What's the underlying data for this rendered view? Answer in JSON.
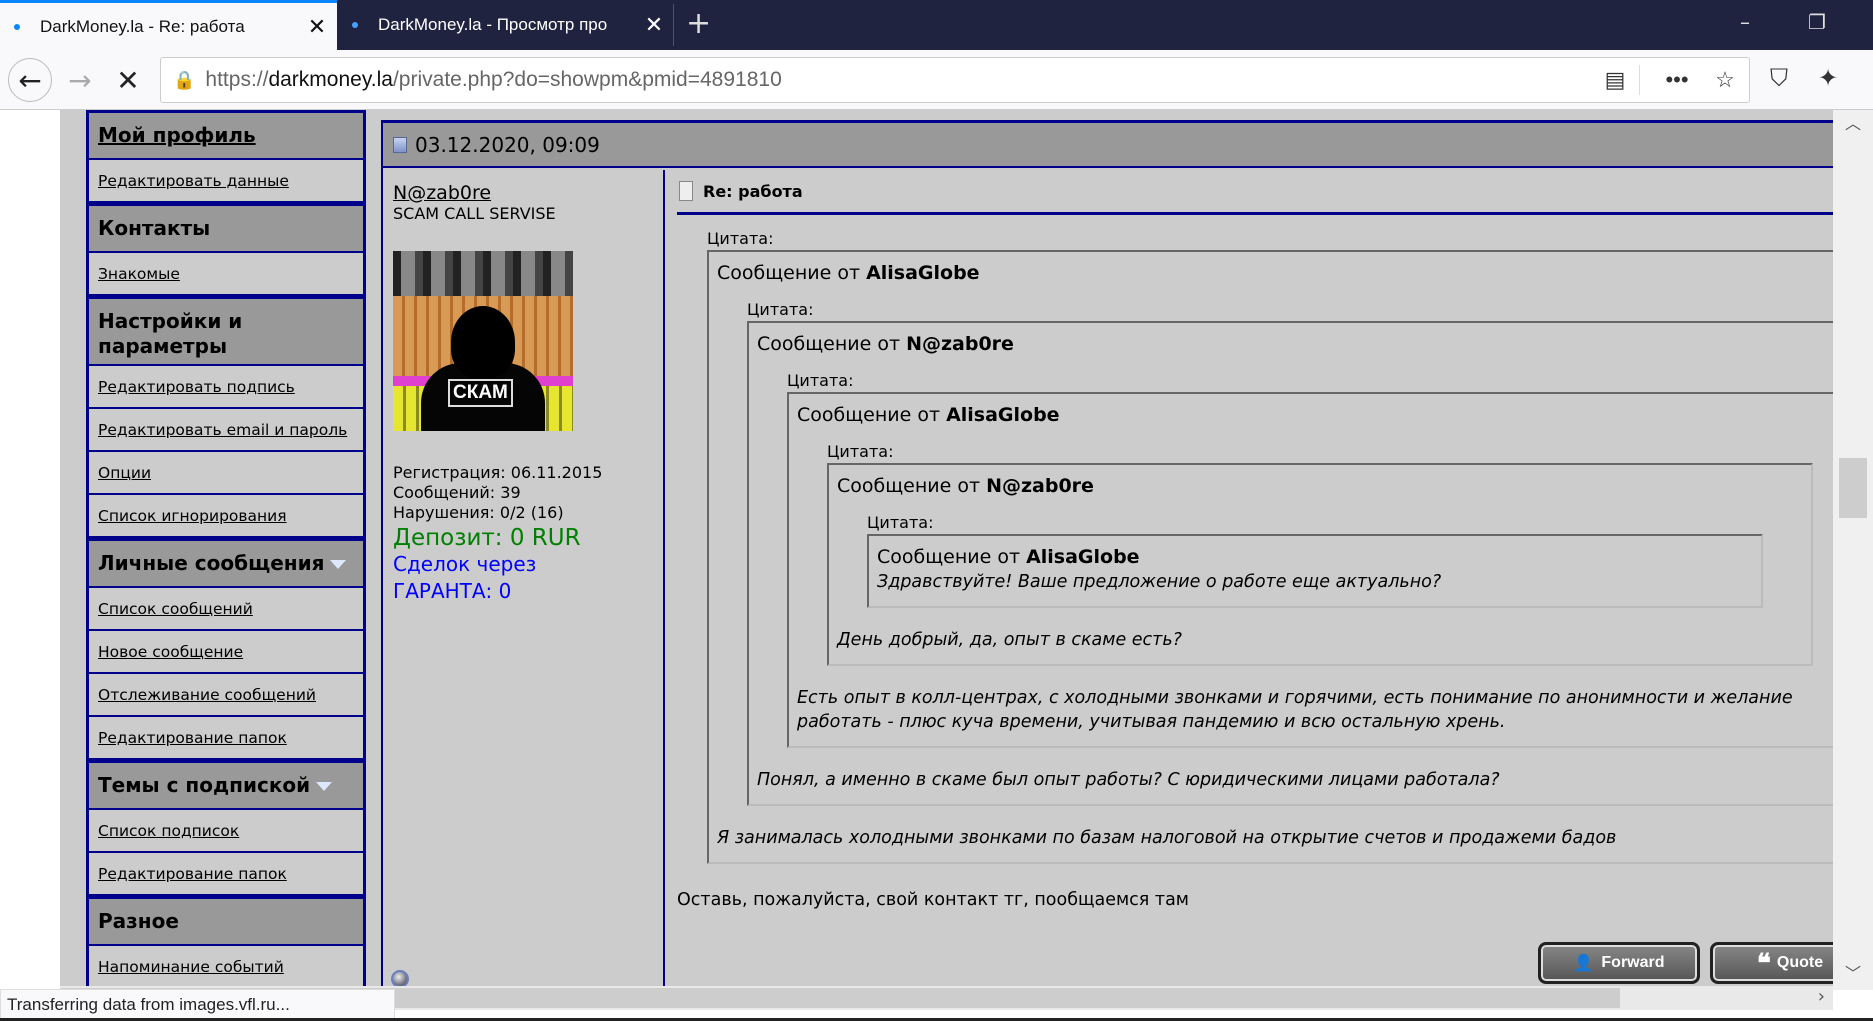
{
  "browser": {
    "tabs": [
      {
        "title": "DarkMoney.la - Re: работа",
        "active": true
      },
      {
        "title": "DarkMoney.la - Просмотр про",
        "active": false
      }
    ],
    "url_scheme": "https://",
    "url_host": "darkmoney.la",
    "url_path": "/private.php?do=showpm&pmid=4891810",
    "status_text": "Transferring data from images.vfl.ru..."
  },
  "sidebar": {
    "sections": [
      {
        "header": "Мой профиль",
        "header_link": true,
        "items": [
          "Редактировать данные"
        ]
      },
      {
        "header": "Контакты",
        "items": [
          "Знакомые"
        ]
      },
      {
        "header": "Настройки и параметры",
        "items": [
          "Редактировать подпись",
          "Редактировать email и пароль",
          "Опции",
          "Список игнорирования"
        ]
      },
      {
        "header": "Личные сообщения",
        "collapsible": true,
        "items": [
          "Список сообщений",
          "Новое сообщение",
          "Отслеживание сообщений",
          "Редактирование папок"
        ]
      },
      {
        "header": "Темы с подпиской",
        "collapsible": true,
        "items": [
          "Список подписок",
          "Редактирование папок"
        ]
      },
      {
        "header": "Разное",
        "items": [
          "Напоминание событий"
        ]
      }
    ]
  },
  "post": {
    "date": "03.12.2020, 09:09",
    "user": {
      "name": "N@zab0re",
      "title": "SCAM CALL SERVISE",
      "avatar_text": "СКАМ",
      "registration": "Регистрация: 06.11.2015",
      "posts": "Сообщений: 39",
      "violations": "Нарушения: 0/2 (16)",
      "deposit": "Депозит: 0 RUR",
      "deals_line1": "Сделок через",
      "deals_line2": "ГАРАНТА: 0"
    },
    "title": "Re: работа",
    "quote_label": "Цитата:",
    "from_prefix": "Сообщение от",
    "quotes": [
      {
        "author": "AlisaGlobe",
        "text": "Я занималась холодными звонками по базам налоговой на открытие счетов и продажеми бадов"
      },
      {
        "author": "N@zab0re",
        "text": "Понял, а именно в скаме был опыт работы? С юридическими лицами работала?"
      },
      {
        "author": "AlisaGlobe",
        "text": "Есть опыт в колл-центрах, с холодными звонками и горячими, есть понимание по анонимности и желание работать - плюс куча времени, учитывая пандемию и всю остальную хрень."
      },
      {
        "author": "N@zab0re",
        "text": "День добрый, да, опыт в скаме есть?"
      },
      {
        "author": "AlisaGlobe",
        "text": "Здравствуйте! Ваше предложение о работе еще актуально?"
      }
    ],
    "body": "Оставь, пожалуйста, свой контакт тг, пообщаемся там",
    "buttons": {
      "forward": "Forward",
      "quote": "Quote"
    }
  },
  "colors": {
    "border": "#00008b",
    "header_bg": "#999999",
    "page_bg": "#cccccc",
    "deposit": "#008000",
    "deals": "#0000ff"
  }
}
